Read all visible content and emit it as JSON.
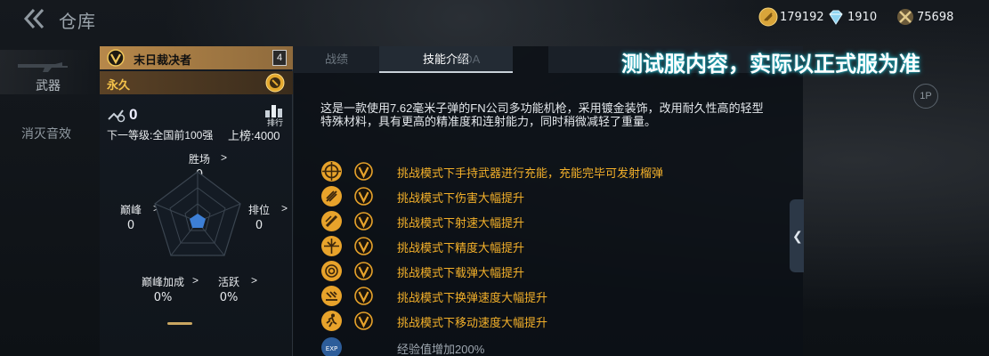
{
  "header": {
    "title": "仓库",
    "currencies": [
      {
        "name": "gold",
        "value": "179192"
      },
      {
        "name": "diamond",
        "value": "1910"
      },
      {
        "name": "token",
        "value": "75698"
      }
    ]
  },
  "nav": {
    "weapon_label": "武器",
    "effect_label": "消灭音效"
  },
  "item": {
    "name": "末日裁决者",
    "level": "4",
    "duration": "永久",
    "kill_count": "0",
    "ranking_label": "排行",
    "next_level": "下一等级:全国前100强",
    "listed": "上榜:4000"
  },
  "stats": {
    "wins_label": "胜场",
    "wins_value": "0",
    "peak_label": "巅峰",
    "peak_value": "0",
    "rank_label": "排位",
    "rank_value": "0",
    "peak_bonus_label": "巅峰加成",
    "peak_bonus_value": "0%",
    "active_label": "活跃",
    "active_value": "0%",
    "arrow": ">"
  },
  "tabs": {
    "record": "战绩",
    "skill": "技能介绍",
    "kda": "KDA"
  },
  "description": "这是一款使用7.62毫米子弹的FN公司多功能机枪，采用镀金装饰，改用耐久性高的轻型特殊材料，具有更高的精准度和连射能力，同时稍微减轻了重量。",
  "skills": [
    {
      "icon": "grenade-launcher-icon",
      "text": "挑战模式下手持武器进行充能，充能完毕可发射榴弹"
    },
    {
      "icon": "damage-up-icon",
      "text": "挑战模式下伤害大幅提升"
    },
    {
      "icon": "fire-rate-icon",
      "text": "挑战模式下射速大幅提升"
    },
    {
      "icon": "accuracy-icon",
      "text": "挑战模式下精度大幅提升"
    },
    {
      "icon": "magazine-icon",
      "text": "挑战模式下载弹大幅提升"
    },
    {
      "icon": "reload-speed-icon",
      "text": "挑战模式下换弹速度大幅提升"
    },
    {
      "icon": "move-speed-icon",
      "text": "挑战模式下移动速度大幅提升"
    },
    {
      "icon": "exp-icon",
      "text": "经验值增加200%"
    }
  ],
  "server_notice": "测试服内容，实际以正式服为准",
  "view_toggle": "1P",
  "colors": {
    "gold_accent": "#c9a661",
    "skill_text": "#f3b02a",
    "notice_glow": "#1fb6c8"
  }
}
